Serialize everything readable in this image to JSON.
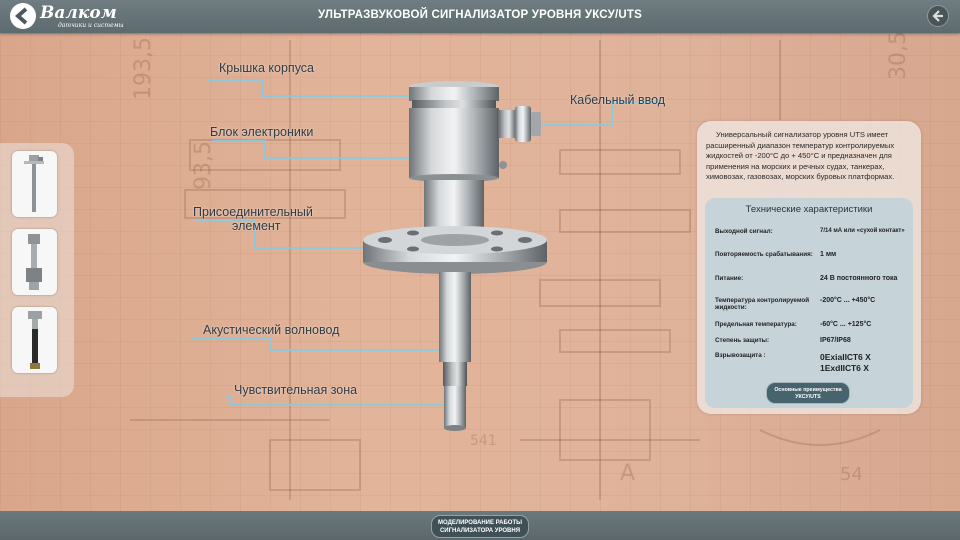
{
  "header": {
    "logo_name": "Валком",
    "logo_tagline": "датчики и системы",
    "title": "УЛЬТРАЗВУКОВОЙ СИГНАЛИЗАТОР УРОВНЯ УКСУ/UTS"
  },
  "labels": {
    "cover": "Крышка корпуса",
    "cable_entry": "Кабельный ввод",
    "electronics": "Блок электроники",
    "connector_line1": "Присоединительный",
    "connector_line2": "элемент",
    "waveguide": "Акустический волновод",
    "sensitive_zone": "Чувствительная зона"
  },
  "info": {
    "intro": "Универсальный сигнализатор уровня UTS имеет расширенный диапазон температур контролируемых жидкостей от -200°С до + 450°С и предназначен для применения на морских и речных судах, танкерах, химовозах, газовозах, морских буровых платформах.",
    "spec_title": "Технические характеристики",
    "specs": [
      {
        "key": "Выходной сигнал:",
        "value": "7/14 мА или «сухой контакт»"
      },
      {
        "key": "Повторяемость срабатывания:",
        "value": "1 мм"
      },
      {
        "key": "Питание:",
        "value": "24 В постоянного тока"
      },
      {
        "key": "Температура контролируемой жидкости:",
        "value": "-200°С ... +450°С"
      },
      {
        "key": "Предельная температура:",
        "value": "-60°С ... +125°С"
      },
      {
        "key": "Степень защиты:",
        "value": "IP67/IP68"
      },
      {
        "key": "Взрывозащита :",
        "value": "0ExiaIIСТ6 Х",
        "value2": "1ExdIIСТ6 Х"
      }
    ],
    "advantages_button": "Основные преимущества УКСУ/UTS"
  },
  "footer": {
    "simulate_button": "МОДЕЛИРОВАНИЕ РАБОТЫ СИГНАЛИЗАТОРА УРОВНЯ"
  },
  "thumbnails": [
    "thumbnail-1",
    "thumbnail-2",
    "thumbnail-3"
  ],
  "colors": {
    "topbar": "#66737a",
    "accent_line": "#7ec3d9",
    "panel_box": "#c6d4d9",
    "button": "#47636d"
  },
  "icons": {
    "back": "back-arrow-icon",
    "logo": "valkom-logo-icon"
  }
}
